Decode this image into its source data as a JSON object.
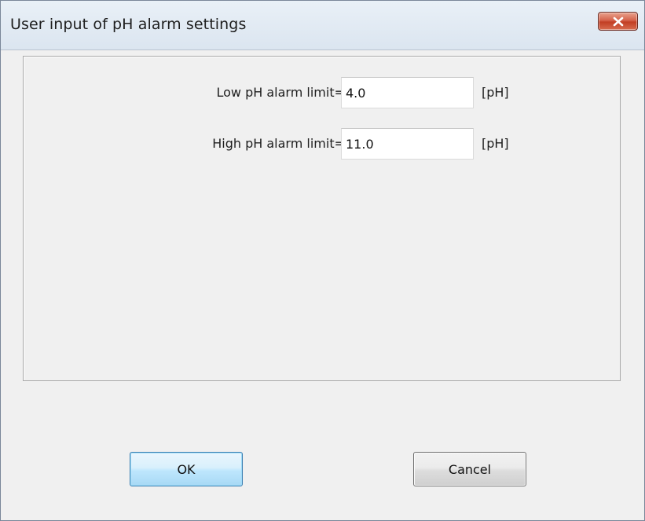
{
  "window": {
    "title": "User input of pH alarm settings"
  },
  "fields": {
    "low": {
      "label": "Low pH alarm limit=",
      "value": "4.0",
      "unit": "[pH]"
    },
    "high": {
      "label": "High pH alarm limit=",
      "value": "11.0",
      "unit": "[pH]"
    }
  },
  "buttons": {
    "ok_label": "OK",
    "cancel_label": "Cancel"
  },
  "icons": {
    "close": "close-icon"
  },
  "colors": {
    "close_button": "#c94a30",
    "ok_button_border": "#3c7fb1",
    "dialog_background": "#f0f0f0"
  }
}
